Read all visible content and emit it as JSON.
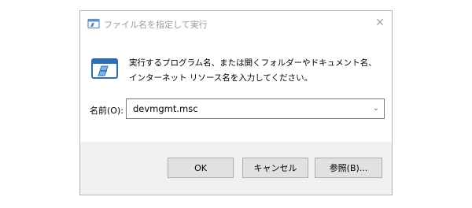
{
  "window": {
    "title": "ファイル名を指定して実行",
    "close_glyph": "✕"
  },
  "body": {
    "description": "実行するプログラム名、または開くフォルダーやドキュメント名、インターネット リソース名を入力してください。"
  },
  "name_field": {
    "label": "名前(O):",
    "value": "devmgmt.msc",
    "dropdown_glyph": "⌄"
  },
  "buttons": {
    "ok": "OK",
    "cancel": "キャンセル",
    "browse": "参照(B)..."
  },
  "icons": {
    "title": "run-icon",
    "main": "run-icon"
  },
  "colors": {
    "icon_blue": "#2b6fb6",
    "footer_bg": "#f0f0f0",
    "button_bg": "#e1e1e1"
  }
}
